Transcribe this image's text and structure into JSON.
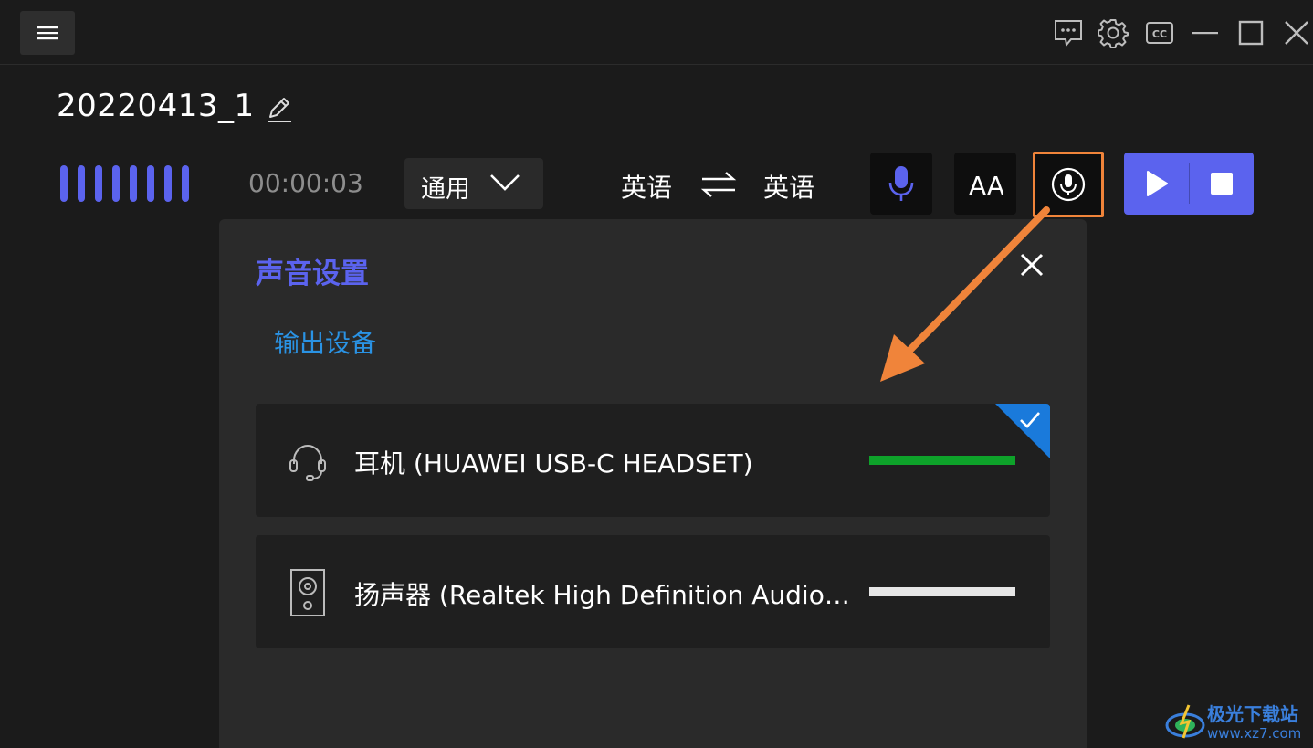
{
  "header": {
    "menu_icon": "hamburger-icon",
    "window_controls": [
      "feedback-icon",
      "settings-gear-icon",
      "cc-subtitle-icon",
      "minimize-icon",
      "maximize-icon",
      "close-icon"
    ]
  },
  "session": {
    "title": "20220413_1",
    "timer": "00:00:03",
    "mode": "通用",
    "source_language": "英语",
    "target_language": "英语",
    "font_button_label": "AA"
  },
  "sound_settings": {
    "title": "声音设置",
    "section_label": "输出设备",
    "devices": [
      {
        "name": "耳机 (HUAWEI USB-C HEADSET)",
        "icon": "headset-icon",
        "selected": true,
        "level_color": "#0ea22a"
      },
      {
        "name": "扬声器 (Realtek High Definition Audio(...",
        "icon": "speaker-icon",
        "selected": false,
        "level_color": "#e6e6e6"
      }
    ]
  },
  "watermark": {
    "line1": "极光下载站",
    "line2": "www.xz7.com"
  },
  "colors": {
    "accent": "#5b63ee",
    "highlight_border": "#f0843a",
    "link_blue": "#2a93e4",
    "selected_corner": "#1a7adb"
  }
}
